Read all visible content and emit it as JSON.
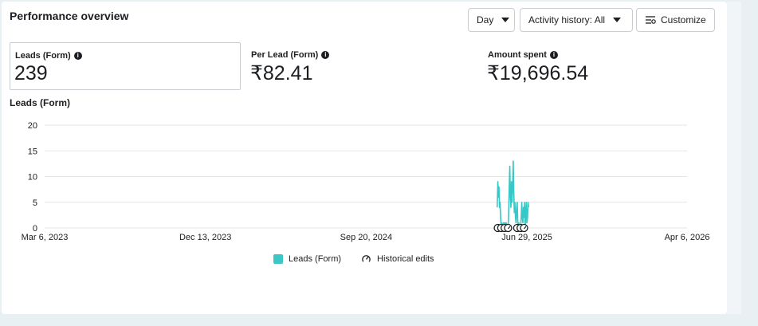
{
  "title": "Performance overview",
  "controls": {
    "day_label": "Day",
    "activity_label": "Activity history: All",
    "customize_label": "Customize"
  },
  "metrics": [
    {
      "label": "Leads (Form)",
      "value": "239"
    },
    {
      "label": "Per Lead (Form)",
      "value": "₹82.41"
    },
    {
      "label": "Amount spent",
      "value": "₹19,696.54"
    }
  ],
  "colors": {
    "series": "#3ac7c5",
    "grid": "#e4e6eb",
    "text": "#1c1e21"
  },
  "chart_data": {
    "type": "line",
    "title": "Leads (Form)",
    "x_ticks": [
      "Mar 6, 2023",
      "Dec 13, 2023",
      "Sep 20, 2024",
      "Jun 29, 2025",
      "Apr 6, 2026"
    ],
    "xlim": [
      "2023-03-06",
      "2026-04-06"
    ],
    "ylim": [
      0,
      20
    ],
    "y_ticks": [
      0,
      5,
      10,
      15,
      20
    ],
    "grid": true,
    "legend_position": "bottom",
    "series": [
      {
        "name": "Leads (Form)",
        "points": [
          [
            "2025-05-08",
            4
          ],
          [
            "2025-05-09",
            9
          ],
          [
            "2025-05-10",
            6
          ],
          [
            "2025-05-11",
            8
          ],
          [
            "2025-05-12",
            4
          ],
          [
            "2025-05-13",
            5
          ],
          [
            "2025-05-14",
            2
          ],
          [
            "2025-05-15",
            0
          ],
          [
            "2025-05-16",
            1
          ],
          [
            "2025-05-17",
            0
          ],
          [
            "2025-05-18",
            0
          ],
          [
            "2025-05-19",
            1
          ],
          [
            "2025-05-20",
            0
          ],
          [
            "2025-05-21",
            1
          ],
          [
            "2025-05-22",
            1
          ],
          [
            "2025-05-23",
            0
          ],
          [
            "2025-05-24",
            1
          ],
          [
            "2025-05-25",
            0
          ],
          [
            "2025-05-26",
            0
          ],
          [
            "2025-05-27",
            0
          ],
          [
            "2025-05-28",
            3
          ],
          [
            "2025-05-29",
            8
          ],
          [
            "2025-05-30",
            12
          ],
          [
            "2025-05-31",
            6
          ],
          [
            "2025-06-01",
            4
          ],
          [
            "2025-06-02",
            9
          ],
          [
            "2025-06-03",
            5
          ],
          [
            "2025-06-04",
            8
          ],
          [
            "2025-06-05",
            13
          ],
          [
            "2025-06-06",
            7
          ],
          [
            "2025-06-07",
            3
          ],
          [
            "2025-06-08",
            5
          ],
          [
            "2025-06-09",
            2
          ],
          [
            "2025-06-10",
            1
          ],
          [
            "2025-06-11",
            4
          ],
          [
            "2025-06-12",
            5
          ],
          [
            "2025-06-13",
            1
          ],
          [
            "2025-06-14",
            0
          ],
          [
            "2025-06-15",
            1
          ],
          [
            "2025-06-16",
            0
          ],
          [
            "2025-06-17",
            0
          ],
          [
            "2025-06-18",
            0
          ],
          [
            "2025-06-19",
            2
          ],
          [
            "2025-06-20",
            5
          ],
          [
            "2025-06-21",
            2
          ],
          [
            "2025-06-22",
            1
          ],
          [
            "2025-06-23",
            4
          ],
          [
            "2025-06-24",
            2
          ],
          [
            "2025-06-25",
            5
          ],
          [
            "2025-06-26",
            0
          ],
          [
            "2025-06-27",
            3
          ],
          [
            "2025-06-28",
            5
          ],
          [
            "2025-06-29",
            1
          ],
          [
            "2025-06-30",
            2
          ],
          [
            "2025-07-01",
            5
          ],
          [
            "2025-07-02",
            4
          ]
        ]
      }
    ],
    "historical_edits": [
      "2025-05-09",
      "2025-05-15",
      "2025-05-21",
      "2025-05-27",
      "2025-06-12",
      "2025-06-18",
      "2025-06-24"
    ],
    "legend": [
      "Leads (Form)",
      "Historical edits"
    ]
  }
}
